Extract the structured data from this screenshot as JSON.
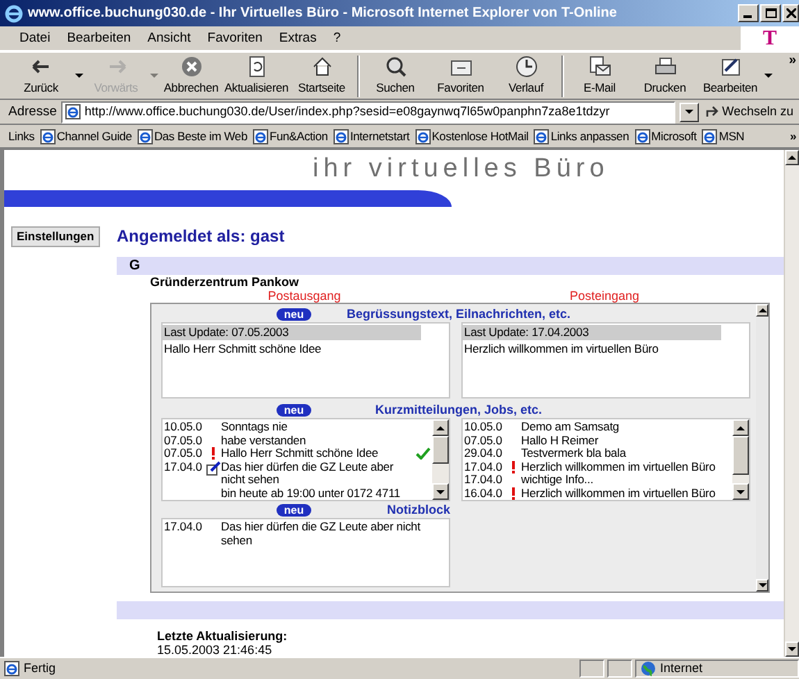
{
  "window": {
    "title": "www.office.buchung030.de - Ihr Virtuelles Büro - Microsoft Internet Explorer von T-Online",
    "brand": "T"
  },
  "menu": [
    "Datei",
    "Bearbeiten",
    "Ansicht",
    "Favoriten",
    "Extras",
    "?"
  ],
  "toolbar": [
    [
      {
        "label": "Zurück",
        "disabled": false,
        "dropdown": true
      },
      {
        "label": "Vorwärts",
        "disabled": true,
        "dropdown": true
      },
      {
        "label": "Abbrechen",
        "disabled": false,
        "dropdown": false
      },
      {
        "label": "Aktualisieren",
        "disabled": false,
        "dropdown": false
      },
      {
        "label": "Startseite",
        "disabled": false,
        "dropdown": false
      }
    ],
    [
      {
        "label": "Suchen",
        "disabled": false,
        "dropdown": false
      },
      {
        "label": "Favoriten",
        "disabled": false,
        "dropdown": false
      },
      {
        "label": "Verlauf",
        "disabled": false,
        "dropdown": false
      }
    ],
    [
      {
        "label": "E-Mail",
        "disabled": false,
        "dropdown": false
      },
      {
        "label": "Drucken",
        "disabled": false,
        "dropdown": false
      },
      {
        "label": "Bearbeiten",
        "disabled": false,
        "dropdown": true
      }
    ]
  ],
  "toolbar_more": "»",
  "address": {
    "label": "Adresse",
    "value": "http://www.office.buchung030.de/User/index.php?sesid=e08gaynwq7l65w0panphn7za8e1tdzyr",
    "go": "Wechseln zu"
  },
  "links": {
    "label": "Links",
    "items": [
      "Channel Guide",
      "Das Beste im Web",
      "Fun&Action",
      "Internetstart",
      "Kostenlose HotMail",
      "Links anpassen",
      "Microsoft",
      "MSN"
    ],
    "more": "»"
  },
  "page": {
    "banner": "ihr virtuelles Büro",
    "settings_button": "Einstellungen",
    "login": "Angemeldet als: gast",
    "group": "G",
    "center": "Gründerzentrum Pankow",
    "columns": [
      "Postausgang",
      "Posteingang"
    ],
    "sections": [
      {
        "kind": "split",
        "badge": "neu",
        "heading": "Begrüssungstext, Eilnachrichten, etc.",
        "boxes": [
          {
            "kind": "update",
            "update": "Last Update: 07.05.2003",
            "text": "Hallo Herr Schmitt schöne Idee"
          },
          {
            "kind": "update",
            "update": "Last Update: 17.04.2003",
            "text": "Herzlich willkommen im virtuellen Büro"
          }
        ]
      },
      {
        "kind": "split",
        "badge": "neu",
        "heading": "Kurzmitteilungen, Jobs, etc.",
        "boxes": [
          {
            "kind": "list",
            "scrollbar": true,
            "rows": [
              {
                "date": "10.05.0",
                "urgent": false,
                "note": false,
                "lines": [
                  "Sonntags nie"
                ],
                "checked": false
              },
              {
                "date": "07.05.0",
                "urgent": false,
                "note": false,
                "lines": [
                  "habe verstanden"
                ],
                "checked": false
              },
              {
                "date": "07.05.0",
                "urgent": true,
                "note": false,
                "lines": [
                  "Hallo Herr Schmitt schöne Idee"
                ],
                "checked": true
              },
              {
                "date": "17.04.0",
                "urgent": false,
                "note": true,
                "lines": [
                  "Das hier dürfen die GZ Leute aber nicht sehen",
                  "bin heute ab 19:00 unter 0172 4711"
                ],
                "checked": false
              }
            ]
          },
          {
            "kind": "list",
            "scrollbar": true,
            "rows": [
              {
                "date": "10.05.0",
                "urgent": false,
                "note": false,
                "lines": [
                  "Demo am Samsatg"
                ]
              },
              {
                "date": "07.05.0",
                "urgent": false,
                "note": false,
                "lines": [
                  "Hallo H Reimer"
                ]
              },
              {
                "date": "29.04.0",
                "urgent": false,
                "note": false,
                "lines": [
                  "Testvermerk bla bala"
                ]
              },
              {
                "date": "17.04.0",
                "urgent": true,
                "note": false,
                "lines": [
                  "Herzlich willkommen im virtuellen Büro"
                ]
              },
              {
                "date": "17.04.0",
                "urgent": false,
                "note": false,
                "lines": [
                  "wichtige Info..."
                ]
              },
              {
                "date": "16.04.0",
                "urgent": true,
                "note": false,
                "lines": [
                  "Herzlich willkommen im virtuellen Büro"
                ]
              }
            ]
          }
        ]
      },
      {
        "kind": "single",
        "badge": "neu",
        "heading": "Notizblock",
        "boxes": [
          {
            "kind": "list",
            "rows": [
              {
                "date": "17.04.0",
                "urgent": false,
                "note": false,
                "lines": [
                  "Das hier dürfen die GZ Leute aber nicht sehen"
                ]
              }
            ]
          }
        ]
      }
    ],
    "last_update": {
      "label": "Letzte Aktualisierung:",
      "value": "15.05.2003 21:46:45"
    }
  },
  "status_bar": {
    "text": "Fertig",
    "zone": "Internet"
  }
}
